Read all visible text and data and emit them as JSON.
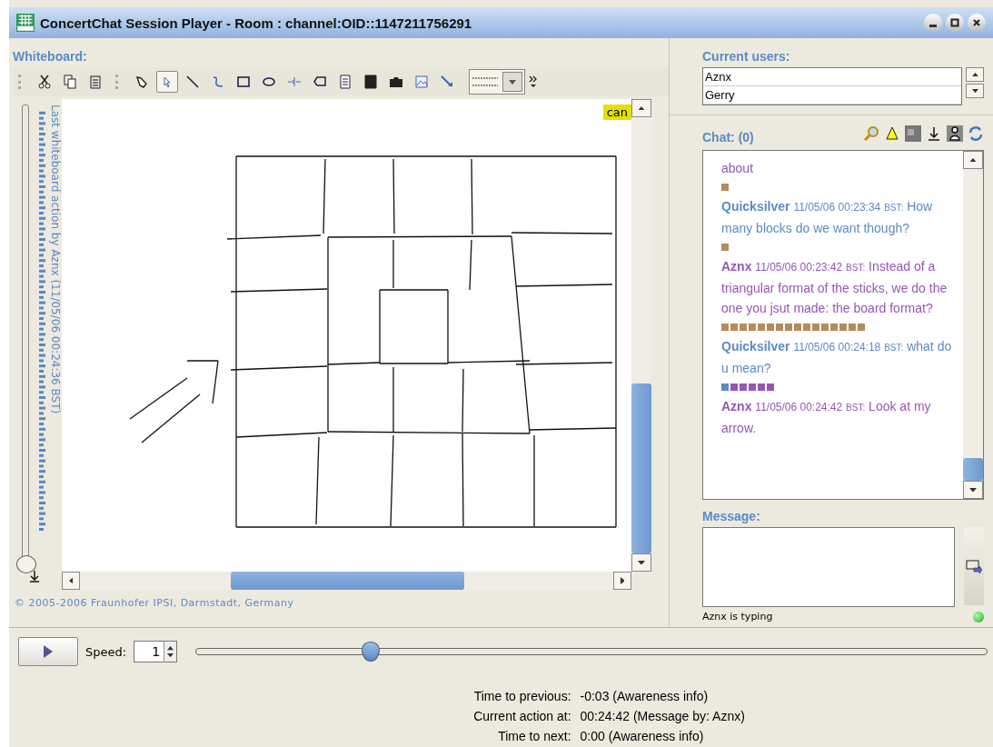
{
  "window": {
    "title": "ConcertChat Session Player - Room : channel:OID::1147211756291"
  },
  "whiteboard": {
    "label": "Whiteboard:",
    "tools": [
      {
        "selected": false
      },
      {
        "selected": true
      },
      {
        "selected": false
      },
      {
        "selected": false
      },
      {
        "selected": false
      },
      {
        "selected": false
      },
      {
        "selected": false
      },
      {
        "selected": false
      },
      {
        "selected": false
      },
      {
        "selected": false
      },
      {
        "selected": false
      },
      {
        "selected": false
      },
      {
        "selected": false
      }
    ],
    "last_action": "Last whiteboard action by Aznx (11/05/06 00:24:36 BST)",
    "history": {
      "level": 0
    },
    "tag": "can",
    "copyright": "© 2005-2006 Fraunhofer IPSI, Darmstadt, Germany"
  },
  "users": {
    "label": "Current users:",
    "items": [
      "Aznx",
      "Gerry"
    ]
  },
  "chat": {
    "label": "Chat: (0)",
    "entries": [
      {
        "kind": "continuation",
        "text": "about",
        "color": "#9457b8"
      },
      {
        "kind": "awareness",
        "squares": [
          {
            "color": "#b38b5d"
          }
        ]
      },
      {
        "kind": "message",
        "author": "Quicksilver",
        "time": "11/05/06 00:23:34",
        "zone": "BST:",
        "text": "How many blocks do we want though?",
        "color": "#5b8ac6"
      },
      {
        "kind": "awareness",
        "squares": [
          {
            "color": "#b38b5d"
          }
        ]
      },
      {
        "kind": "message",
        "author": "Aznx",
        "time": "11/05/06 00:23:42",
        "zone": "BST:",
        "text": "Instead of a triangular format of the sticks, we do the one you jsut made: the board format?",
        "color": "#9457b8"
      },
      {
        "kind": "awareness",
        "squares": [
          {
            "color": "#b38b5d"
          },
          {
            "color": "#b38b5d"
          },
          {
            "color": "#b38b5d"
          },
          {
            "color": "#b38b5d"
          },
          {
            "color": "#b38b5d"
          },
          {
            "color": "#b38b5d"
          },
          {
            "color": "#b38b5d"
          },
          {
            "color": "#b38b5d"
          },
          {
            "color": "#b38b5d"
          },
          {
            "color": "#b38b5d"
          },
          {
            "color": "#b38b5d"
          },
          {
            "color": "#b38b5d"
          },
          {
            "color": "#b38b5d"
          },
          {
            "color": "#b38b5d"
          },
          {
            "color": "#b38b5d"
          },
          {
            "color": "#b38b5d"
          }
        ]
      },
      {
        "kind": "message",
        "author": "Quicksilver",
        "time": "11/05/06 00:24:18",
        "zone": "BST:",
        "text": "what do u mean?",
        "color": "#5b8ac6"
      },
      {
        "kind": "awareness",
        "squares": [
          {
            "color": "#5b8ac6"
          },
          {
            "color": "#9457b8"
          },
          {
            "color": "#9457b8"
          },
          {
            "color": "#9457b8"
          },
          {
            "color": "#9457b8"
          },
          {
            "color": "#9457b8"
          }
        ]
      },
      {
        "kind": "message",
        "author": "Aznx",
        "time": "11/05/06 00:24:42",
        "zone": "BST:",
        "text": "Look at my arrow.",
        "color": "#9457b8"
      }
    ]
  },
  "message": {
    "label": "Message:",
    "status": "Aznx is typing",
    "online": true
  },
  "player": {
    "speed_label": "Speed:",
    "speed": "1",
    "level": 0.22,
    "info": [
      {
        "label": "Time to previous:",
        "value": "-0:03 (Awareness info)"
      },
      {
        "label": "Current action at:",
        "value": "00:24:42 (Message by: Aznx)"
      },
      {
        "label": "Time to next:",
        "value": "0:00 (Awareness info)"
      }
    ]
  }
}
